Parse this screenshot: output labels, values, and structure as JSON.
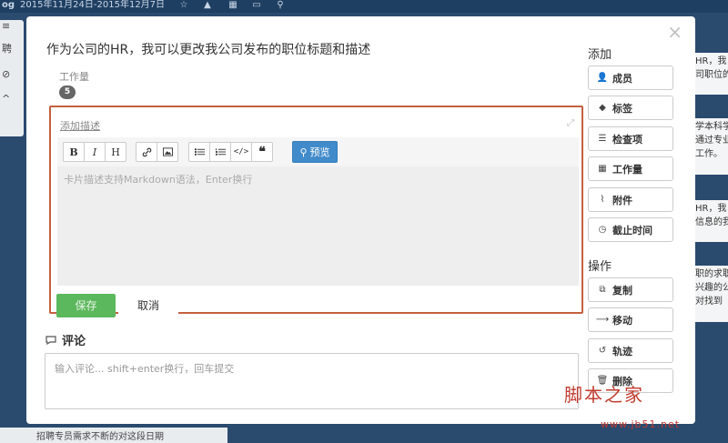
{
  "background": {
    "project_abbrev": "og",
    "date_range": "2015年11月24日-2015年12月7日",
    "left_items": [
      "≡",
      "聘",
      "⊘",
      "^"
    ],
    "bottom_card_text": "招聘专员需求不断的对这段日期",
    "right_cards": [
      "HR，我",
      "司职位的",
      "学本科学",
      "通过专业",
      "工作。",
      "HR，我",
      "信息的我",
      "职的求职",
      "兴趣的公",
      "对找到"
    ]
  },
  "modal": {
    "title": "作为公司的HR，我可以更改我公司发布的职位标题和描述",
    "close": "×",
    "workload_label": "工作量",
    "workload_value": "5",
    "add_description": "添加描述",
    "toolbar": {
      "bold": "B",
      "italic": "I",
      "heading": "H",
      "preview": "预览"
    },
    "editor_placeholder": "卡片描述支持Markdown语法，Enter换行",
    "save": "保存",
    "cancel": "取消",
    "comments_title": "评论",
    "comment_placeholder": "输入评论... shift+enter换行，回车提交"
  },
  "sidebar": {
    "add_title": "添加",
    "add_buttons": [
      {
        "label": "成员",
        "icon": "user-plus-icon"
      },
      {
        "label": "标签",
        "icon": "tag-icon"
      },
      {
        "label": "检查项",
        "icon": "checklist-icon"
      },
      {
        "label": "工作量",
        "icon": "grid-icon"
      },
      {
        "label": "附件",
        "icon": "paperclip-icon"
      },
      {
        "label": "截止时间",
        "icon": "clock-icon"
      }
    ],
    "ops_title": "操作",
    "ops_buttons": [
      {
        "label": "复制",
        "icon": "copy-icon"
      },
      {
        "label": "移动",
        "icon": "arrow-right-icon"
      },
      {
        "label": "轨迹",
        "icon": "history-icon"
      },
      {
        "label": "删除",
        "icon": "trash-icon"
      }
    ]
  },
  "watermark": {
    "text": "脚本之家",
    "url": "www.jb51.net"
  },
  "colors": {
    "highlight_border": "#c4603f",
    "save_green": "#5cb85c",
    "preview_blue": "#428bca",
    "board_bg": "#2a4a6e"
  }
}
